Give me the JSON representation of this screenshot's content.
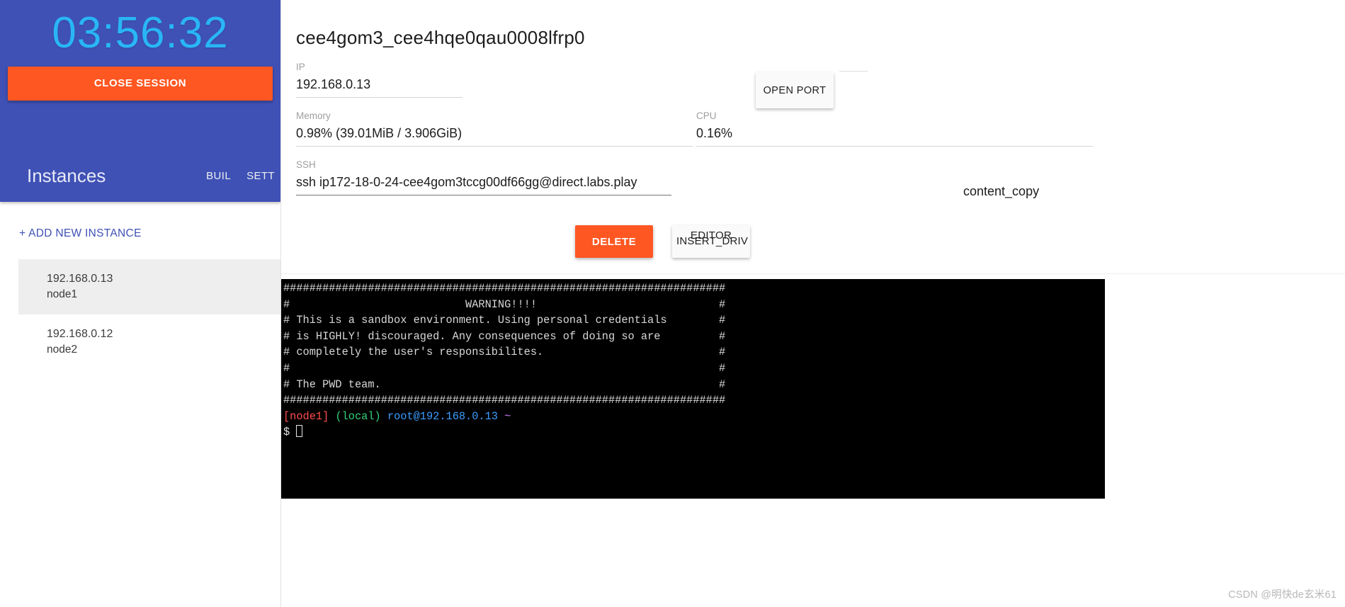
{
  "sidebar": {
    "timer": "03:56:32",
    "close_session_label": "CLOSE SESSION",
    "instances_title": "Instances",
    "build_label": "BUIL",
    "settings_label": "SETT",
    "add_instance_label": "+ ADD NEW INSTANCE",
    "instances": [
      {
        "ip": "192.168.0.13",
        "name": "node1",
        "selected": true
      },
      {
        "ip": "192.168.0.12",
        "name": "node2",
        "selected": false
      }
    ]
  },
  "main": {
    "session_id": "cee4gom3_cee4hqe0qau0008lfrp0",
    "fields": {
      "ip_label": "IP",
      "ip_value": "192.168.0.13",
      "memory_label": "Memory",
      "memory_value": "0.98% (39.01MiB / 3.906GiB)",
      "cpu_label": "CPU",
      "cpu_value": "0.16%",
      "ssh_label": "SSH",
      "ssh_value": "ssh ip172-18-0-24-cee4gom3tccg00df66gg@direct.labs.play"
    },
    "open_port_label": "OPEN PORT",
    "content_copy_label": "content_copy",
    "delete_label": "DELETE",
    "editor_label": "EDITOR",
    "insert_drive_label": "INSERT_DRIV"
  },
  "terminal": {
    "lines": [
      "####################################################################",
      "#                           WARNING!!!!                            #",
      "# This is a sandbox environment. Using personal credentials        #",
      "# is HIGHLY! discouraged. Any consequences of doing so are         #",
      "# completely the user's responsibilites.                           #",
      "#                                                                  #",
      "# The PWD team.                                                    #",
      "####################################################################"
    ],
    "prompt": {
      "node": "[node1]",
      "scope": "(local)",
      "user_host": "root@192.168.0.13",
      "path": "~",
      "symbol": "$"
    }
  },
  "watermark": "CSDN @明快de玄米61",
  "colors": {
    "sidebar_blue": "#3f51b5",
    "accent_orange": "#ff5722",
    "timer_blue": "#29b6f6",
    "link_blue": "#3f51b5"
  }
}
